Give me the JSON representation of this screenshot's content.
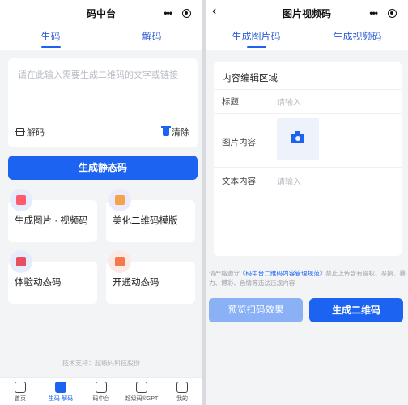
{
  "left": {
    "nav_title": "码中台",
    "tabs": [
      {
        "label": "生码",
        "active": true
      },
      {
        "label": "解码",
        "active": false
      }
    ],
    "input_placeholder": "请在此输入需要生成二维码的文字或链接",
    "decode_label": "解码",
    "clear_label": "清除",
    "primary_button": "生成静态码",
    "features": [
      {
        "label": "生成图片 · 视频码",
        "icon": "image-video-icon"
      },
      {
        "label": "美化二维码模版",
        "icon": "beautify-icon"
      },
      {
        "label": "体验动态码",
        "icon": "experience-icon"
      },
      {
        "label": "开通动态码",
        "icon": "activate-icon"
      }
    ],
    "footer_note": "技术支持：超级码科技股份",
    "tabbar": [
      {
        "label": "首页",
        "icon": "home-icon",
        "active": false
      },
      {
        "label": "生码·解码",
        "icon": "grid-icon",
        "active": true
      },
      {
        "label": "码中台",
        "icon": "cube-icon",
        "active": false
      },
      {
        "label": "超级码®GPT",
        "icon": "gpt-icon",
        "active": false
      },
      {
        "label": "我的",
        "icon": "user-icon",
        "active": false
      }
    ]
  },
  "right": {
    "nav_title": "图片视频码",
    "tabs": [
      {
        "label": "生成图片码",
        "active": true
      },
      {
        "label": "生成视频码",
        "active": false
      }
    ],
    "editor_title": "内容编辑区域",
    "fields": {
      "title_label": "标题",
      "title_placeholder": "请输入",
      "image_label": "图片内容",
      "text_label": "文本内容",
      "text_placeholder": "请输入"
    },
    "notice": {
      "pre": "请严格遵守",
      "link": "《码中台二维码内容管理规范》",
      "post": "禁止上传含有侵权、恶搞、暴力、博彩、色情等违法违规内容"
    },
    "preview_button": "预览扫码效果",
    "generate_button": "生成二维码"
  },
  "colors": {
    "accent": "#1b63f0",
    "preview_button": "#8ab0f6",
    "background": "#f3f4f6"
  }
}
